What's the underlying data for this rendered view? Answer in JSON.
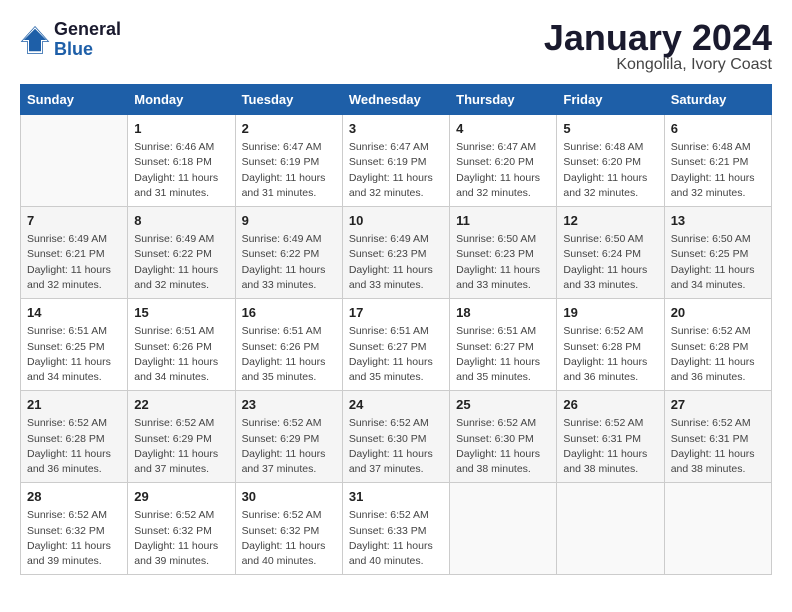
{
  "header": {
    "logo_line1": "General",
    "logo_line2": "Blue",
    "title": "January 2024",
    "subtitle": "Kongolila, Ivory Coast"
  },
  "days_of_week": [
    "Sunday",
    "Monday",
    "Tuesday",
    "Wednesday",
    "Thursday",
    "Friday",
    "Saturday"
  ],
  "weeks": [
    [
      {
        "day": "",
        "info": ""
      },
      {
        "day": "1",
        "info": "Sunrise: 6:46 AM\nSunset: 6:18 PM\nDaylight: 11 hours\nand 31 minutes."
      },
      {
        "day": "2",
        "info": "Sunrise: 6:47 AM\nSunset: 6:19 PM\nDaylight: 11 hours\nand 31 minutes."
      },
      {
        "day": "3",
        "info": "Sunrise: 6:47 AM\nSunset: 6:19 PM\nDaylight: 11 hours\nand 32 minutes."
      },
      {
        "day": "4",
        "info": "Sunrise: 6:47 AM\nSunset: 6:20 PM\nDaylight: 11 hours\nand 32 minutes."
      },
      {
        "day": "5",
        "info": "Sunrise: 6:48 AM\nSunset: 6:20 PM\nDaylight: 11 hours\nand 32 minutes."
      },
      {
        "day": "6",
        "info": "Sunrise: 6:48 AM\nSunset: 6:21 PM\nDaylight: 11 hours\nand 32 minutes."
      }
    ],
    [
      {
        "day": "7",
        "info": "Sunrise: 6:49 AM\nSunset: 6:21 PM\nDaylight: 11 hours\nand 32 minutes."
      },
      {
        "day": "8",
        "info": "Sunrise: 6:49 AM\nSunset: 6:22 PM\nDaylight: 11 hours\nand 32 minutes."
      },
      {
        "day": "9",
        "info": "Sunrise: 6:49 AM\nSunset: 6:22 PM\nDaylight: 11 hours\nand 33 minutes."
      },
      {
        "day": "10",
        "info": "Sunrise: 6:49 AM\nSunset: 6:23 PM\nDaylight: 11 hours\nand 33 minutes."
      },
      {
        "day": "11",
        "info": "Sunrise: 6:50 AM\nSunset: 6:23 PM\nDaylight: 11 hours\nand 33 minutes."
      },
      {
        "day": "12",
        "info": "Sunrise: 6:50 AM\nSunset: 6:24 PM\nDaylight: 11 hours\nand 33 minutes."
      },
      {
        "day": "13",
        "info": "Sunrise: 6:50 AM\nSunset: 6:25 PM\nDaylight: 11 hours\nand 34 minutes."
      }
    ],
    [
      {
        "day": "14",
        "info": "Sunrise: 6:51 AM\nSunset: 6:25 PM\nDaylight: 11 hours\nand 34 minutes."
      },
      {
        "day": "15",
        "info": "Sunrise: 6:51 AM\nSunset: 6:26 PM\nDaylight: 11 hours\nand 34 minutes."
      },
      {
        "day": "16",
        "info": "Sunrise: 6:51 AM\nSunset: 6:26 PM\nDaylight: 11 hours\nand 35 minutes."
      },
      {
        "day": "17",
        "info": "Sunrise: 6:51 AM\nSunset: 6:27 PM\nDaylight: 11 hours\nand 35 minutes."
      },
      {
        "day": "18",
        "info": "Sunrise: 6:51 AM\nSunset: 6:27 PM\nDaylight: 11 hours\nand 35 minutes."
      },
      {
        "day": "19",
        "info": "Sunrise: 6:52 AM\nSunset: 6:28 PM\nDaylight: 11 hours\nand 36 minutes."
      },
      {
        "day": "20",
        "info": "Sunrise: 6:52 AM\nSunset: 6:28 PM\nDaylight: 11 hours\nand 36 minutes."
      }
    ],
    [
      {
        "day": "21",
        "info": "Sunrise: 6:52 AM\nSunset: 6:28 PM\nDaylight: 11 hours\nand 36 minutes."
      },
      {
        "day": "22",
        "info": "Sunrise: 6:52 AM\nSunset: 6:29 PM\nDaylight: 11 hours\nand 37 minutes."
      },
      {
        "day": "23",
        "info": "Sunrise: 6:52 AM\nSunset: 6:29 PM\nDaylight: 11 hours\nand 37 minutes."
      },
      {
        "day": "24",
        "info": "Sunrise: 6:52 AM\nSunset: 6:30 PM\nDaylight: 11 hours\nand 37 minutes."
      },
      {
        "day": "25",
        "info": "Sunrise: 6:52 AM\nSunset: 6:30 PM\nDaylight: 11 hours\nand 38 minutes."
      },
      {
        "day": "26",
        "info": "Sunrise: 6:52 AM\nSunset: 6:31 PM\nDaylight: 11 hours\nand 38 minutes."
      },
      {
        "day": "27",
        "info": "Sunrise: 6:52 AM\nSunset: 6:31 PM\nDaylight: 11 hours\nand 38 minutes."
      }
    ],
    [
      {
        "day": "28",
        "info": "Sunrise: 6:52 AM\nSunset: 6:32 PM\nDaylight: 11 hours\nand 39 minutes."
      },
      {
        "day": "29",
        "info": "Sunrise: 6:52 AM\nSunset: 6:32 PM\nDaylight: 11 hours\nand 39 minutes."
      },
      {
        "day": "30",
        "info": "Sunrise: 6:52 AM\nSunset: 6:32 PM\nDaylight: 11 hours\nand 40 minutes."
      },
      {
        "day": "31",
        "info": "Sunrise: 6:52 AM\nSunset: 6:33 PM\nDaylight: 11 hours\nand 40 minutes."
      },
      {
        "day": "",
        "info": ""
      },
      {
        "day": "",
        "info": ""
      },
      {
        "day": "",
        "info": ""
      }
    ]
  ]
}
